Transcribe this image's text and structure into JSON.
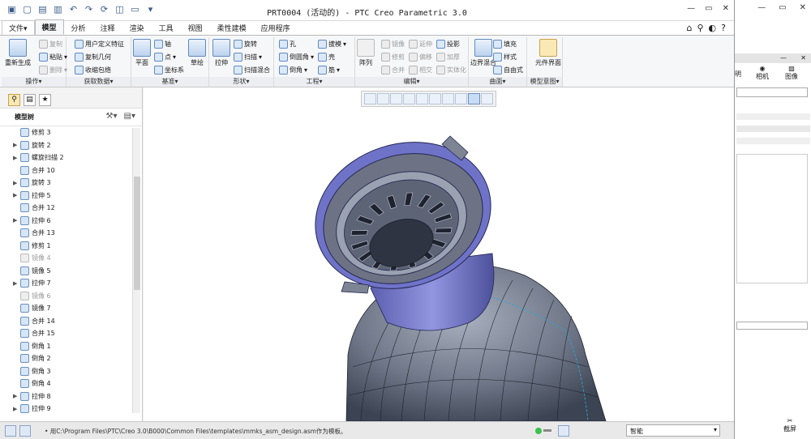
{
  "window": {
    "title": "PRT0004 (活动的) - PTC Creo Parametric 3.0",
    "minimize": "—",
    "restore": "▭",
    "close": "✕"
  },
  "menu_tabs": [
    "文件▾",
    "模型",
    "分析",
    "注释",
    "渲染",
    "工具",
    "视图",
    "柔性建模",
    "应用程序"
  ],
  "menu_right_icons": [
    "⌂",
    "⚲",
    "◐",
    "?"
  ],
  "ribbon": {
    "groups": {
      "operations": "操作▾",
      "get_data": "获取数据▾",
      "datum": "基准▾",
      "shapes": "形状▾",
      "engineering": "工程▾",
      "editing": "编辑▾",
      "surfaces": "曲面▾",
      "model_intent": "模型意图▾"
    },
    "operations": {
      "regenerate": "重新生成",
      "copy": "复制",
      "paste": "粘贴",
      "delete": "删除"
    },
    "get_data": {
      "udf": "用户定义特征",
      "copy_geom": "复制几何",
      "shrinkwrap": "收缩包络"
    },
    "datum": {
      "plane": "平面",
      "axis": "轴",
      "point": "点",
      "csys": "坐标系",
      "sketch": "草绘"
    },
    "shapes": {
      "extrude": "拉伸",
      "revolve": "旋转",
      "sweep": "扫描",
      "swept_blend": "扫描混合"
    },
    "engineering": {
      "hole": "孔",
      "round": "倒圆角",
      "chamfer": "倒角",
      "draft": "拔模",
      "shell": "壳",
      "rib": "筋"
    },
    "editing": {
      "pattern": "阵列",
      "mirror": "镜像",
      "trim": "修剪",
      "merge": "合并",
      "extend": "延伸",
      "offset": "偏移",
      "intersect": "相交",
      "project": "投影",
      "thicken": "加厚",
      "solidify": "实体化"
    },
    "surfaces": {
      "boundary_blend": "边界混合",
      "fill": "填充",
      "style": "样式",
      "freestyle": "自由式"
    },
    "model_intent": {
      "component_interface": "元件界面"
    }
  },
  "model_tree": {
    "header": "模型树",
    "nodes": [
      {
        "label": "修剪 3",
        "expandable": false,
        "disabled": false
      },
      {
        "label": "旋转 2",
        "expandable": true,
        "disabled": false
      },
      {
        "label": "螺旋扫描 2",
        "expandable": true,
        "disabled": false
      },
      {
        "label": "合并 10",
        "expandable": false,
        "disabled": false
      },
      {
        "label": "旋转 3",
        "expandable": true,
        "disabled": false
      },
      {
        "label": "拉伸 5",
        "expandable": true,
        "disabled": false
      },
      {
        "label": "合并 12",
        "expandable": false,
        "disabled": false
      },
      {
        "label": "拉伸 6",
        "expandable": true,
        "disabled": false
      },
      {
        "label": "合并 13",
        "expandable": false,
        "disabled": false
      },
      {
        "label": "修剪 1",
        "expandable": false,
        "disabled": false
      },
      {
        "label": "镜像 4",
        "expandable": false,
        "disabled": true
      },
      {
        "label": "镜像 5",
        "expandable": false,
        "disabled": false
      },
      {
        "label": "拉伸 7",
        "expandable": true,
        "disabled": false
      },
      {
        "label": "镜像 6",
        "expandable": false,
        "disabled": true
      },
      {
        "label": "镜像 7",
        "expandable": false,
        "disabled": false
      },
      {
        "label": "合并 14",
        "expandable": false,
        "disabled": false
      },
      {
        "label": "合并 15",
        "expandable": false,
        "disabled": false
      },
      {
        "label": "倒角 1",
        "expandable": false,
        "disabled": false
      },
      {
        "label": "倒角 2",
        "expandable": false,
        "disabled": false
      },
      {
        "label": "倒角 3",
        "expandable": false,
        "disabled": false
      },
      {
        "label": "倒角 4",
        "expandable": false,
        "disabled": false
      },
      {
        "label": "拉伸 8",
        "expandable": true,
        "disabled": false
      },
      {
        "label": "拉伸 9",
        "expandable": true,
        "disabled": false
      }
    ]
  },
  "status": {
    "message": "• 用C:\\Program Files\\PTC\\Creo 3.0\\B000\\Common Files\\templates\\mmks_asm_design.asm作为模板。",
    "filter": "智能"
  },
  "right_app": {
    "labels": [
      "明",
      "相机",
      "图像",
      "截屏"
    ]
  },
  "colors": {
    "model_blue": "#6f73c8",
    "model_body": "#6e7687",
    "accent": "#5f8bc2"
  }
}
